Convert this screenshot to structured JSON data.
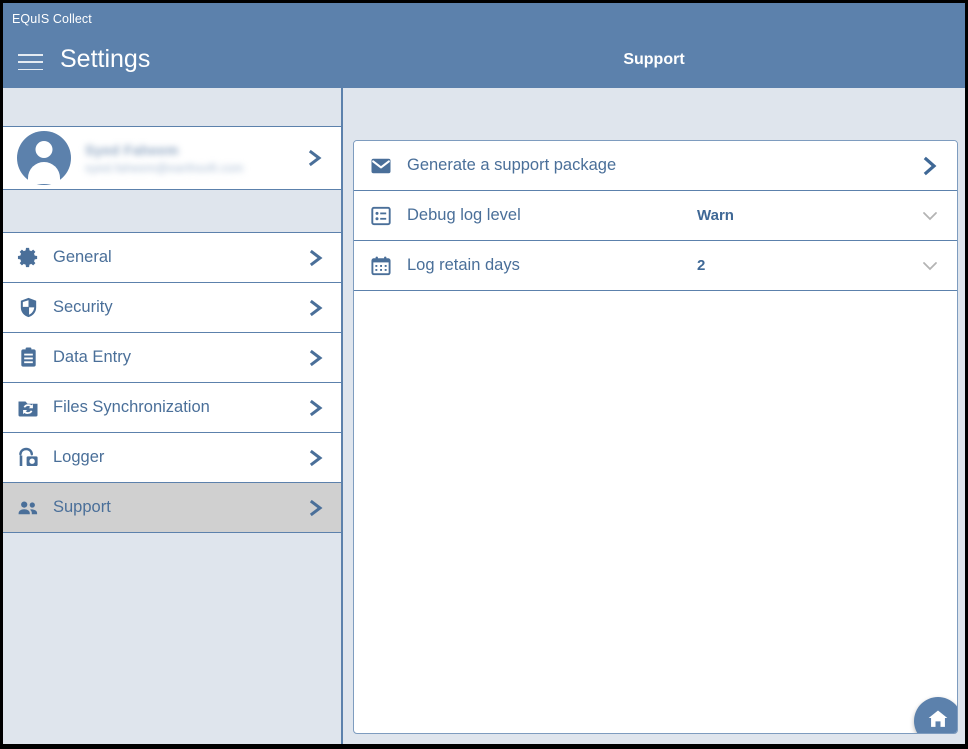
{
  "window": {
    "app_title": "EQuIS Collect",
    "controls": {
      "minimize": "–",
      "maximize": "□",
      "close": "✕"
    }
  },
  "header": {
    "title": "Settings",
    "menu_icon": "hamburger-icon"
  },
  "sidebar": {
    "profile": {
      "name": "Syed Faheem",
      "email": "syed.faheem@earthsoft.com",
      "redacted": true,
      "avatar_icon": "person-avatar-icon",
      "chevron": "chevron-right-icon"
    },
    "items": [
      {
        "label": "General",
        "icon": "gear-icon",
        "selected": false
      },
      {
        "label": "Security",
        "icon": "shield-icon",
        "selected": false
      },
      {
        "label": "Data Entry",
        "icon": "clipboard-icon",
        "selected": false
      },
      {
        "label": "Files Synchronization",
        "icon": "folder-sync-icon",
        "selected": false
      },
      {
        "label": "Logger",
        "icon": "logger-lock-icon",
        "selected": false
      },
      {
        "label": "Support",
        "icon": "people-icon",
        "selected": true
      }
    ]
  },
  "main": {
    "title": "Support",
    "rows": [
      {
        "label": "Generate a support package",
        "value": "",
        "icon": "envelope-icon",
        "affordance": "chevron-right-icon"
      },
      {
        "label": "Debug log level",
        "value": "Warn",
        "icon": "list-details-icon",
        "affordance": "chevron-down-icon"
      },
      {
        "label": "Log retain days",
        "value": "2",
        "icon": "calendar-icon",
        "affordance": "chevron-down-icon"
      }
    ],
    "fab": {
      "icon": "home-icon",
      "label": "Home"
    }
  },
  "colors": {
    "brand_blue": "#5c81ac",
    "panel_bg": "#dfe5ed",
    "accent_text": "#4a6f99",
    "selected_row": "#d0d0d0",
    "white": "#ffffff"
  }
}
